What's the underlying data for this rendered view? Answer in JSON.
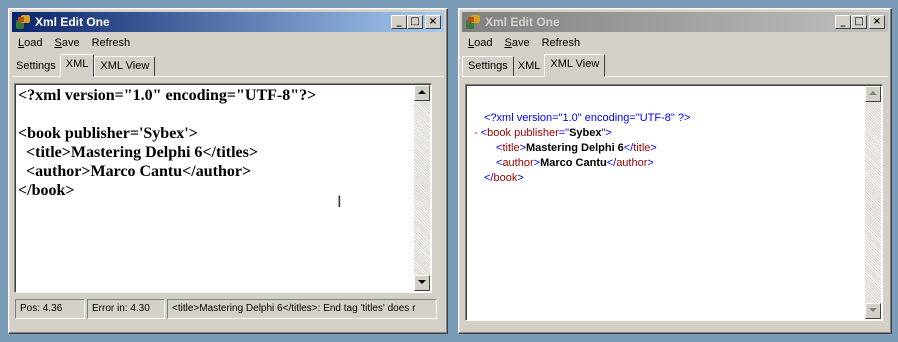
{
  "left_window": {
    "title": "Xml Edit One",
    "menu": {
      "load": "Load",
      "save": "Save",
      "refresh": "Refresh"
    },
    "tabs": [
      "Settings",
      "XML",
      "XML View"
    ],
    "active_tab": "XML",
    "editor_lines": [
      "<?xml version=\"1.0\" encoding=\"UTF-8\"?>",
      "",
      "<book publisher='Sybex'>",
      "  <title>Mastering Delphi 6</titles>",
      "  <author>Marco Cantu</author>",
      "</book>"
    ],
    "status": {
      "pos": "Pos: 4.36",
      "error": "Error in: 4.30",
      "message": "<title>Mastering Delphi 6</titles>: End tag 'titles' does r"
    }
  },
  "right_window": {
    "title": "Xml Edit One",
    "menu": {
      "load": "Load",
      "save": "Save",
      "refresh": "Refresh"
    },
    "tabs": [
      "Settings",
      "XML",
      "XML View"
    ],
    "active_tab": "XML View",
    "view": {
      "declaration": "<?xml version=\"1.0\" encoding=\"UTF-8\" ?>",
      "collapse_marker": "-",
      "root_tag": "book",
      "attr_name": "publisher",
      "attr_value": "Sybex",
      "children": [
        {
          "tag": "title",
          "text": "Mastering Delphi 6"
        },
        {
          "tag": "author",
          "text": "Marco Cantu"
        }
      ]
    }
  },
  "caption_buttons": {
    "minimize": "_",
    "maximize": "□",
    "close": "×"
  }
}
